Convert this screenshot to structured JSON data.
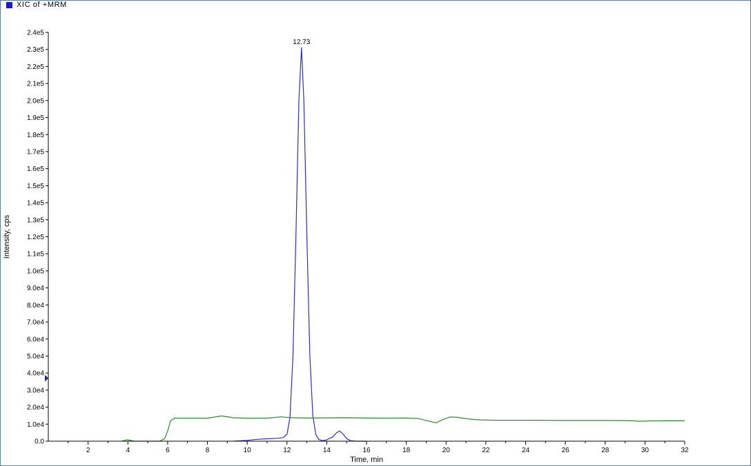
{
  "legend": {
    "label": "XIC of +MRM",
    "color": "#1a1ad6"
  },
  "chart_data": {
    "type": "line",
    "xlabel": "Time, min",
    "ylabel": "Intensity, cps",
    "xlim": [
      0,
      32
    ],
    "ylim": [
      0,
      240000
    ],
    "x_ticks": [
      2,
      4,
      6,
      8,
      10,
      12,
      14,
      16,
      18,
      20,
      22,
      24,
      26,
      28,
      30,
      32
    ],
    "y_ticks": [
      {
        "v": 0,
        "label": "0.0"
      },
      {
        "v": 10000,
        "label": "1.0e4"
      },
      {
        "v": 20000,
        "label": "2.0e4"
      },
      {
        "v": 30000,
        "label": "3.0e4"
      },
      {
        "v": 40000,
        "label": "4.0e4"
      },
      {
        "v": 50000,
        "label": "5.0e4"
      },
      {
        "v": 60000,
        "label": "6.0e4"
      },
      {
        "v": 70000,
        "label": "7.0e4"
      },
      {
        "v": 80000,
        "label": "8.0e4"
      },
      {
        "v": 90000,
        "label": "9.0e4"
      },
      {
        "v": 100000,
        "label": "1.0e5"
      },
      {
        "v": 110000,
        "label": "1.1e5"
      },
      {
        "v": 120000,
        "label": "1.2e5"
      },
      {
        "v": 130000,
        "label": "1.3e5"
      },
      {
        "v": 140000,
        "label": "1.4e5"
      },
      {
        "v": 150000,
        "label": "1.5e5"
      },
      {
        "v": 160000,
        "label": "1.6e5"
      },
      {
        "v": 170000,
        "label": "1.7e5"
      },
      {
        "v": 180000,
        "label": "1.8e5"
      },
      {
        "v": 190000,
        "label": "1.9e5"
      },
      {
        "v": 200000,
        "label": "2.0e5"
      },
      {
        "v": 210000,
        "label": "2.1e5"
      },
      {
        "v": 220000,
        "label": "2.2e5"
      },
      {
        "v": 230000,
        "label": "2.3e5"
      },
      {
        "v": 240000,
        "label": "2.4e5"
      }
    ],
    "annotations": [
      {
        "text": "12.73",
        "x": 12.73,
        "y": 231000
      }
    ],
    "marker": {
      "y": 37000,
      "color": "#1a2a8a"
    },
    "series": [
      {
        "color": "#2b2bd0",
        "points": [
          [
            9.3,
            0
          ],
          [
            9.6,
            200
          ],
          [
            10.0,
            500
          ],
          [
            10.5,
            1100
          ],
          [
            11.0,
            1400
          ],
          [
            11.5,
            1700
          ],
          [
            11.8,
            2100
          ],
          [
            12.0,
            4000
          ],
          [
            12.15,
            14000
          ],
          [
            12.3,
            50000
          ],
          [
            12.45,
            120000
          ],
          [
            12.6,
            200000
          ],
          [
            12.73,
            231000
          ],
          [
            12.85,
            200000
          ],
          [
            13.0,
            120000
          ],
          [
            13.15,
            50000
          ],
          [
            13.3,
            15000
          ],
          [
            13.45,
            4000
          ],
          [
            13.6,
            1000
          ],
          [
            13.8,
            300
          ],
          [
            14.0,
            800
          ],
          [
            14.3,
            2500
          ],
          [
            14.5,
            5000
          ],
          [
            14.65,
            6000
          ],
          [
            14.8,
            4500
          ],
          [
            15.0,
            1500
          ],
          [
            15.2,
            300
          ],
          [
            15.5,
            0
          ],
          [
            16.0,
            0
          ]
        ]
      },
      {
        "color": "#2e8b2e",
        "points": [
          [
            3.7,
            0
          ],
          [
            3.85,
            600
          ],
          [
            4.0,
            800
          ],
          [
            4.15,
            400
          ],
          [
            4.35,
            0
          ],
          [
            5.6,
            0
          ],
          [
            5.85,
            1500
          ],
          [
            6.0,
            6000
          ],
          [
            6.15,
            12000
          ],
          [
            6.35,
            13500
          ],
          [
            7.0,
            13500
          ],
          [
            8.0,
            13500
          ],
          [
            8.7,
            14800
          ],
          [
            9.3,
            13800
          ],
          [
            10.0,
            13500
          ],
          [
            11.0,
            13500
          ],
          [
            11.7,
            14300
          ],
          [
            12.2,
            13800
          ],
          [
            13.0,
            13600
          ],
          [
            14.0,
            13700
          ],
          [
            15.0,
            13800
          ],
          [
            16.0,
            13600
          ],
          [
            17.0,
            13500
          ],
          [
            18.0,
            13600
          ],
          [
            18.6,
            13300
          ],
          [
            19.0,
            12200
          ],
          [
            19.5,
            10800
          ],
          [
            19.8,
            12500
          ],
          [
            20.2,
            14200
          ],
          [
            20.6,
            14000
          ],
          [
            21.0,
            13200
          ],
          [
            21.7,
            12500
          ],
          [
            22.5,
            12300
          ],
          [
            24.0,
            12300
          ],
          [
            26.0,
            12200
          ],
          [
            28.0,
            12200
          ],
          [
            29.2,
            12100
          ],
          [
            29.8,
            11700
          ],
          [
            30.2,
            11900
          ],
          [
            31.0,
            12000
          ],
          [
            32.0,
            12000
          ]
        ]
      }
    ]
  }
}
